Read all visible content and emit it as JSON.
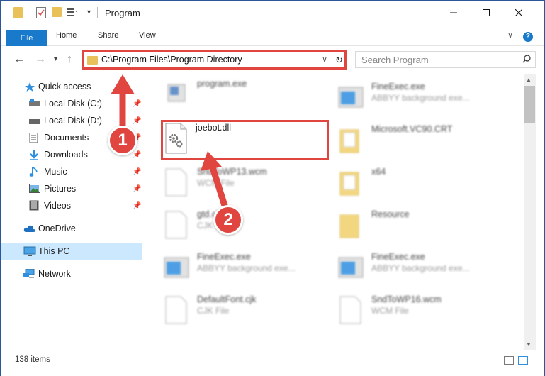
{
  "window": {
    "title": "Program"
  },
  "ribbon": {
    "tabs": [
      "File",
      "Home",
      "Share",
      "View"
    ]
  },
  "address": {
    "path": "C:\\Program Files\\Program Directory"
  },
  "search": {
    "placeholder": "Search Program"
  },
  "sidebar": {
    "items": [
      {
        "label": "Quick access",
        "icon": "star-icon",
        "pinned": false
      },
      {
        "label": "Local Disk (C:)",
        "icon": "drive-icon",
        "pinned": true
      },
      {
        "label": "Local Disk (D:)",
        "icon": "drive-icon",
        "pinned": true
      },
      {
        "label": "Documents",
        "icon": "documents-icon",
        "pinned": true
      },
      {
        "label": "Downloads",
        "icon": "download-icon",
        "pinned": true
      },
      {
        "label": "Music",
        "icon": "music-icon",
        "pinned": true
      },
      {
        "label": "Pictures",
        "icon": "pictures-icon",
        "pinned": true
      },
      {
        "label": "Videos",
        "icon": "videos-icon",
        "pinned": true
      },
      {
        "label": "OneDrive",
        "icon": "cloud-icon",
        "pinned": false
      },
      {
        "label": "This PC",
        "icon": "pc-icon",
        "pinned": false
      },
      {
        "label": "Network",
        "icon": "network-icon",
        "pinned": false
      }
    ]
  },
  "files": {
    "left": [
      {
        "name": "program.exe",
        "type": ""
      },
      {
        "name": "joebot.dll",
        "type": ""
      },
      {
        "name": "SndToWP13.wcm",
        "type": "WCM File"
      },
      {
        "name": "gtd.cjk",
        "type": "CJK File"
      },
      {
        "name": "FineExec.exe",
        "type": "ABBYY background exe..."
      },
      {
        "name": "DefaultFont.cjk",
        "type": "CJK File"
      }
    ],
    "right": [
      {
        "name": "FineExec.exe",
        "type": "ABBYY background exe..."
      },
      {
        "name": "Microsoft.VC90.CRT",
        "type": ""
      },
      {
        "name": "x64",
        "type": ""
      },
      {
        "name": "Resource",
        "type": ""
      },
      {
        "name": "FineExec.exe",
        "type": "ABBYY background exe..."
      },
      {
        "name": "SndToWP16.wcm",
        "type": "WCM File"
      }
    ]
  },
  "status": {
    "items": "138 items"
  },
  "annotations": {
    "step1": "1",
    "step2": "2"
  },
  "colors": {
    "accent": "#1979ca",
    "highlight": "#e0463f",
    "selected": "#cce8ff"
  }
}
